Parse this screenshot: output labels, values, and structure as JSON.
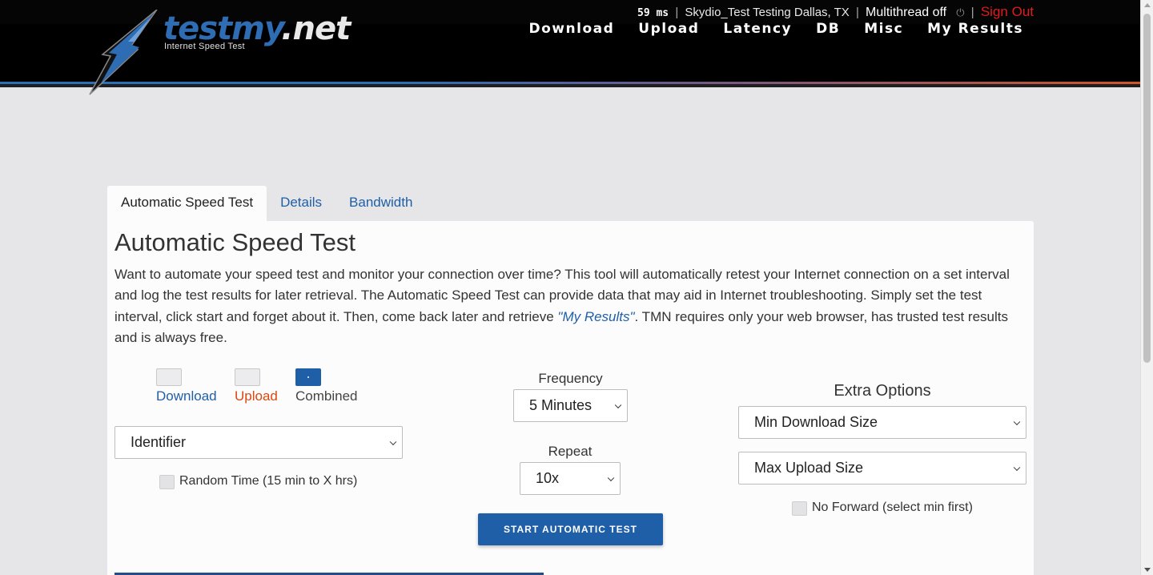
{
  "topbar": {
    "latency": "59 ms",
    "server": "Skydio_Test Testing Dallas, TX",
    "multithread": "Multithread off",
    "sign_out": "Sign Out"
  },
  "header": {
    "logo_part1": "testmy",
    "logo_part2": ".net",
    "logo_sub": "Internet Speed Test",
    "nav": [
      "Download",
      "Upload",
      "Latency",
      "DB",
      "Misc",
      "My Results"
    ]
  },
  "tabs": [
    "Automatic Speed Test",
    "Details",
    "Bandwidth"
  ],
  "main": {
    "title": "Automatic Speed Test",
    "intro_before": "Want to automate your speed test and monitor your connection over time? This tool will automatically retest your Internet connection on a set interval and log the test results for later retrieval. The Automatic Speed Test can provide data that may aid in Internet troubleshooting. Simply set the test interval, click start and forget about it. Then, come back later and retrieve ",
    "intro_link": "\"My Results\"",
    "intro_after": ". TMN requires only your web browser, has trusted test results and is always free.",
    "test_type": {
      "download": "Download",
      "upload": "Upload",
      "combined": "Combined",
      "selected": "Combined"
    },
    "identifier": "Identifier",
    "random_time": "Random Time (15 min to X hrs)",
    "frequency_label": "Frequency",
    "frequency_value": "5 Minutes",
    "repeat_label": "Repeat",
    "repeat_value": "10x",
    "start_button": "START AUTOMATIC TEST",
    "extra_options_title": "Extra Options",
    "min_download": "Min Download Size",
    "max_upload": "Max Upload Size",
    "no_forward": "No Forward (select min first)"
  },
  "colors": {
    "accent": "#1f5fa8",
    "upload": "#d9480f",
    "sign_out": "#e21b1b"
  }
}
